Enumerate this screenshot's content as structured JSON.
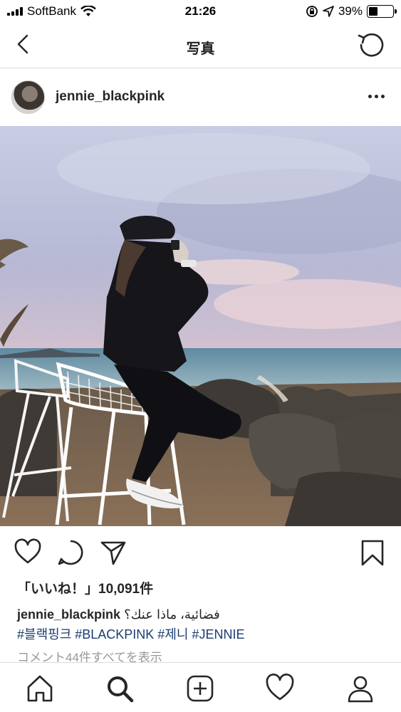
{
  "status_bar": {
    "carrier": "SoftBank",
    "time": "21:26",
    "battery": "39%",
    "battery_level": 0.39
  },
  "nav": {
    "title": "写真",
    "back_icon": "chevron-left-icon",
    "refresh_icon": "refresh-icon"
  },
  "post": {
    "username": "jennie_blackpink",
    "avatar_icon": "avatar",
    "more_icon": "more-icon",
    "likes": "「いいね！」10,091件",
    "caption_username": "jennie_blackpink",
    "caption_text": "فضائية، ماذا عنك؟",
    "hashtags": "#블랙핑크 #BLACKPINK #제니 #JENNIE",
    "comments_link": "コメント44件すべてを表示"
  },
  "actions": {
    "like_icon": "heart-icon",
    "comment_icon": "comment-icon",
    "share_icon": "send-icon",
    "save_icon": "bookmark-icon"
  },
  "tabbar": {
    "items": [
      "home-icon",
      "search-icon",
      "add-icon",
      "activity-heart-icon",
      "profile-icon"
    ]
  }
}
